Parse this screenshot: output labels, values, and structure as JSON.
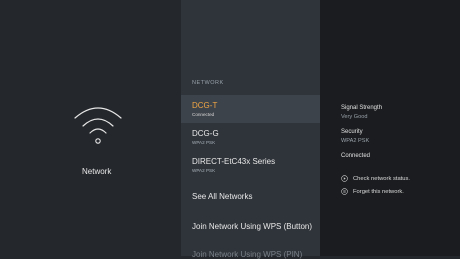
{
  "left": {
    "icon": "wifi-icon",
    "label": "Network"
  },
  "middle": {
    "header": "NETWORK",
    "networks": [
      {
        "name": "DCG-T",
        "status": "Connected",
        "selected": true
      },
      {
        "name": "DCG-G",
        "status": "WPA2 PSK",
        "selected": false
      },
      {
        "name": "DIRECT-EtC43x Series",
        "status": "WPA2 PSK",
        "selected": false
      }
    ],
    "actions": [
      {
        "label": "See All Networks"
      },
      {
        "label": "Join Network Using WPS (Button)"
      },
      {
        "label": "Join Network Using WPS (PIN)"
      }
    ]
  },
  "details": {
    "signal_title": "Signal Strength",
    "signal_value": "Very Good",
    "security_title": "Security",
    "security_value": "WPA2 PSK",
    "connected_label": "Connected",
    "options": [
      {
        "icon": "play-circle-icon",
        "label": "Check network status."
      },
      {
        "icon": "menu-circle-icon",
        "label": "Forget this network."
      }
    ]
  },
  "colors": {
    "accent": "#f0a646",
    "left_bg": "#24272c",
    "middle_bg": "#2f343a",
    "right_bg": "#1a1c1f"
  }
}
